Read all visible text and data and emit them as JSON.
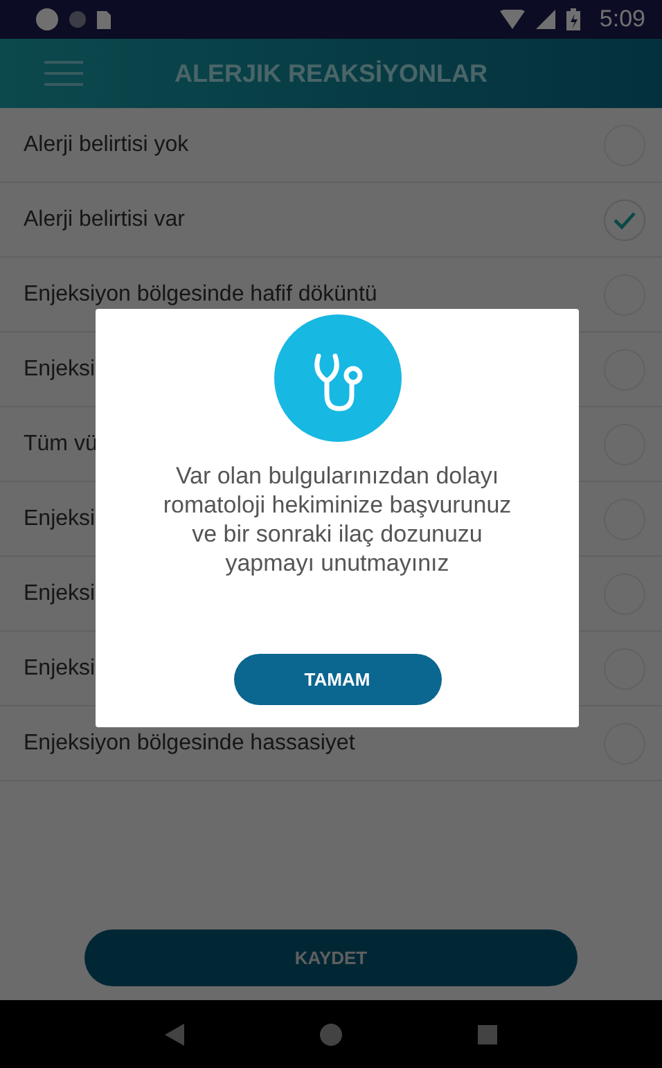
{
  "status_bar": {
    "time": "5:09"
  },
  "app_bar": {
    "title": "ALERJIK REAKSİYONLAR"
  },
  "options": [
    {
      "label": "Alerji belirtisi yok",
      "selected": false
    },
    {
      "label": "Alerji belirtisi var",
      "selected": true
    },
    {
      "label": "Enjeksiyon bölgesinde hafif döküntü",
      "selected": false
    },
    {
      "label": "Enjeksi",
      "selected": false
    },
    {
      "label": "Tüm vü",
      "selected": false
    },
    {
      "label": "Enjeksi",
      "selected": false
    },
    {
      "label": "Enjeksi",
      "selected": false
    },
    {
      "label": "Enjeksi",
      "selected": false
    },
    {
      "label": "Enjeksiyon bölgesinde hassasiyet",
      "selected": false
    }
  ],
  "save_button": "KAYDET",
  "dialog": {
    "message": "Var olan bulgularınızdan dolayı romatoloji hekiminize başvurunuz ve bir sonraki ilaç dozunuzu yapmayı unutmayınız",
    "button": "TAMAM"
  }
}
